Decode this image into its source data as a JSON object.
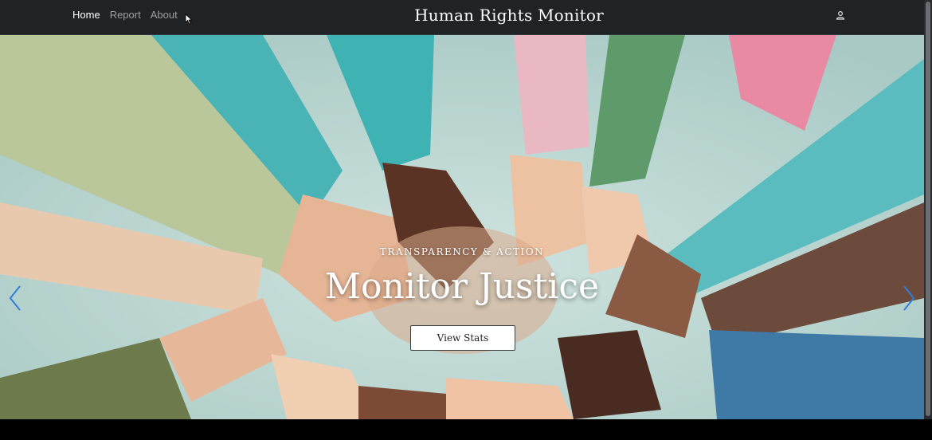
{
  "nav": {
    "links": [
      {
        "label": "Home",
        "active": true
      },
      {
        "label": "Report",
        "active": false
      },
      {
        "label": "About",
        "active": false
      }
    ],
    "title": "Human Rights Monitor",
    "user_icon": "user-icon"
  },
  "hero": {
    "eyebrow": "TRANSPARENCY & ACTION",
    "title": "Monitor Justice",
    "cta_label": "View Stats",
    "prev_icon": "chevron-left-icon",
    "next_icon": "chevron-right-icon",
    "image": "hands-joined-circle-photo"
  },
  "colors": {
    "navbar_bg": "#1f2326",
    "arrow": "#2f7fd6",
    "sky": "#b7d2cd"
  }
}
